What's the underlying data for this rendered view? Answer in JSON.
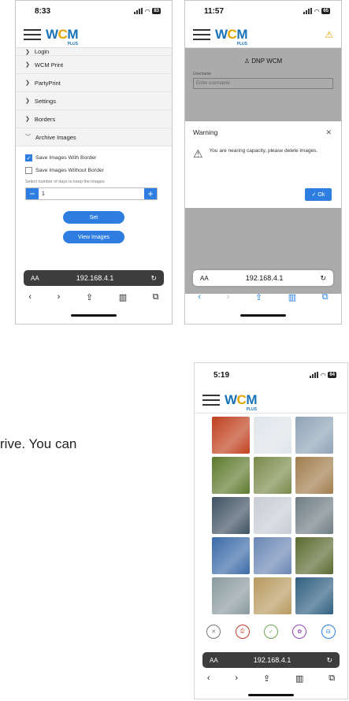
{
  "brand": {
    "logo_w": "W",
    "logo_c": "C",
    "logo_m": "M",
    "logo_plus": "PLUS"
  },
  "phone1": {
    "time": "8:33",
    "battery": "83",
    "menu_partial": "Login",
    "menu": [
      "WCM Print",
      "PartyPrint",
      "Settings",
      "Borders"
    ],
    "archive_label": "Archive Images",
    "save_with_border": "Save Images With Border",
    "save_without_border": "Save Images Without Border",
    "select_days_label": "Select number of days to keep the images",
    "days_value": "1",
    "set_label": "Set",
    "view_images_label": "View Images",
    "url": "192.168.4.1",
    "aa": "AA"
  },
  "phone2": {
    "time": "11:57",
    "battery": "65",
    "login_title": "DNP WCM",
    "username_label": "Username",
    "username_placeholder": "Enter username",
    "modal_title": "Warning",
    "modal_message": "You are nearing capacity, please delete images.",
    "ok_label": "Ok",
    "url": "192.168.4.1",
    "aa": "AA"
  },
  "phone3": {
    "time": "5:19",
    "battery": "64",
    "url": "192.168.4.1",
    "aa": "AA",
    "thumbs": [
      {
        "color": "#c0411f"
      },
      {
        "color": "#dfe5ea"
      },
      {
        "color": "#8fa3b7"
      },
      {
        "color": "#5e7a2d"
      },
      {
        "color": "#7a8a4a"
      },
      {
        "color": "#a07d4c"
      },
      {
        "color": "#3f5161"
      },
      {
        "color": "#c8ccd4"
      },
      {
        "color": "#6f7d84"
      },
      {
        "color": "#3a6aa8"
      },
      {
        "color": "#6a86b4"
      },
      {
        "color": "#5a6a2f"
      },
      {
        "color": "#8a9a9e"
      },
      {
        "color": "#b89a60"
      },
      {
        "color": "#2f5f80"
      }
    ],
    "actions": [
      {
        "icon": "close-icon",
        "color": "#777777",
        "glyph": "✕"
      },
      {
        "icon": "print-icon",
        "color": "#c0392b",
        "glyph": "⎙"
      },
      {
        "icon": "check-icon",
        "color": "#6aa84f",
        "glyph": "✓"
      },
      {
        "icon": "party-print-icon",
        "color": "#8e44ad",
        "glyph": "✿"
      },
      {
        "icon": "archive-icon",
        "color": "#2d7ee0",
        "glyph": "⊟"
      }
    ]
  },
  "caption": "rive. You can"
}
